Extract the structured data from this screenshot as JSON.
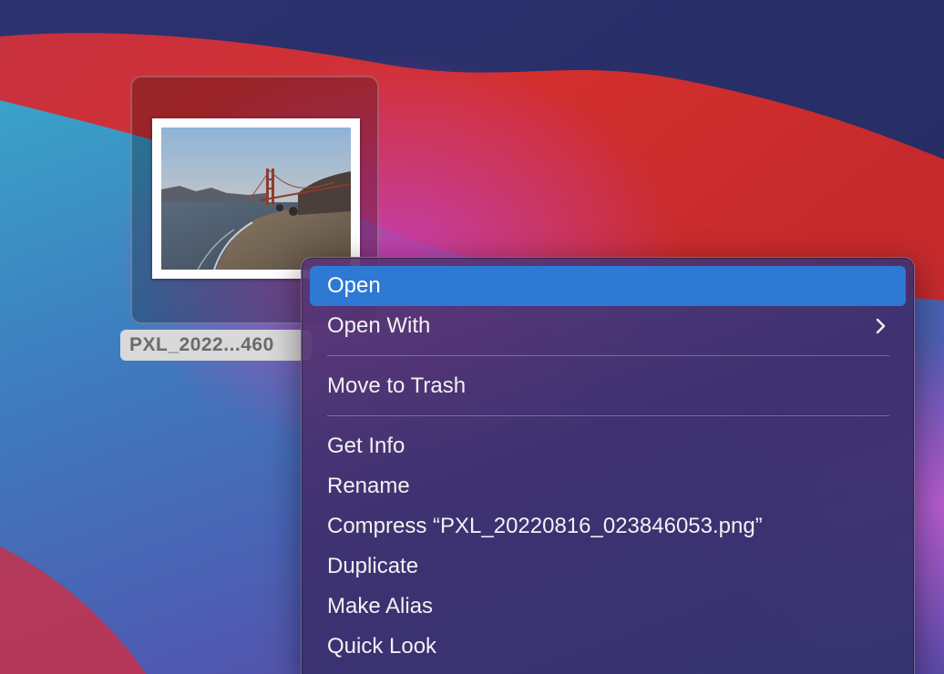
{
  "desktop": {
    "file": {
      "label": "PXL_2022...460",
      "thumbnail_icon": "photo-thumbnail-golden-gate-bridge"
    }
  },
  "context_menu": {
    "sections": [
      {
        "items": [
          {
            "label": "Open",
            "highlighted": true
          },
          {
            "label": "Open With",
            "has_submenu": true
          }
        ]
      },
      {
        "items": [
          {
            "label": "Move to Trash"
          }
        ]
      },
      {
        "items": [
          {
            "label": "Get Info"
          },
          {
            "label": "Rename"
          },
          {
            "label": "Compress “PXL_20220816_023846053.png”"
          },
          {
            "label": "Duplicate"
          },
          {
            "label": "Make Alias"
          },
          {
            "label": "Quick Look"
          }
        ]
      }
    ],
    "submenu_icon": "chevron-right-icon",
    "highlight_color": "#2d79d3"
  }
}
